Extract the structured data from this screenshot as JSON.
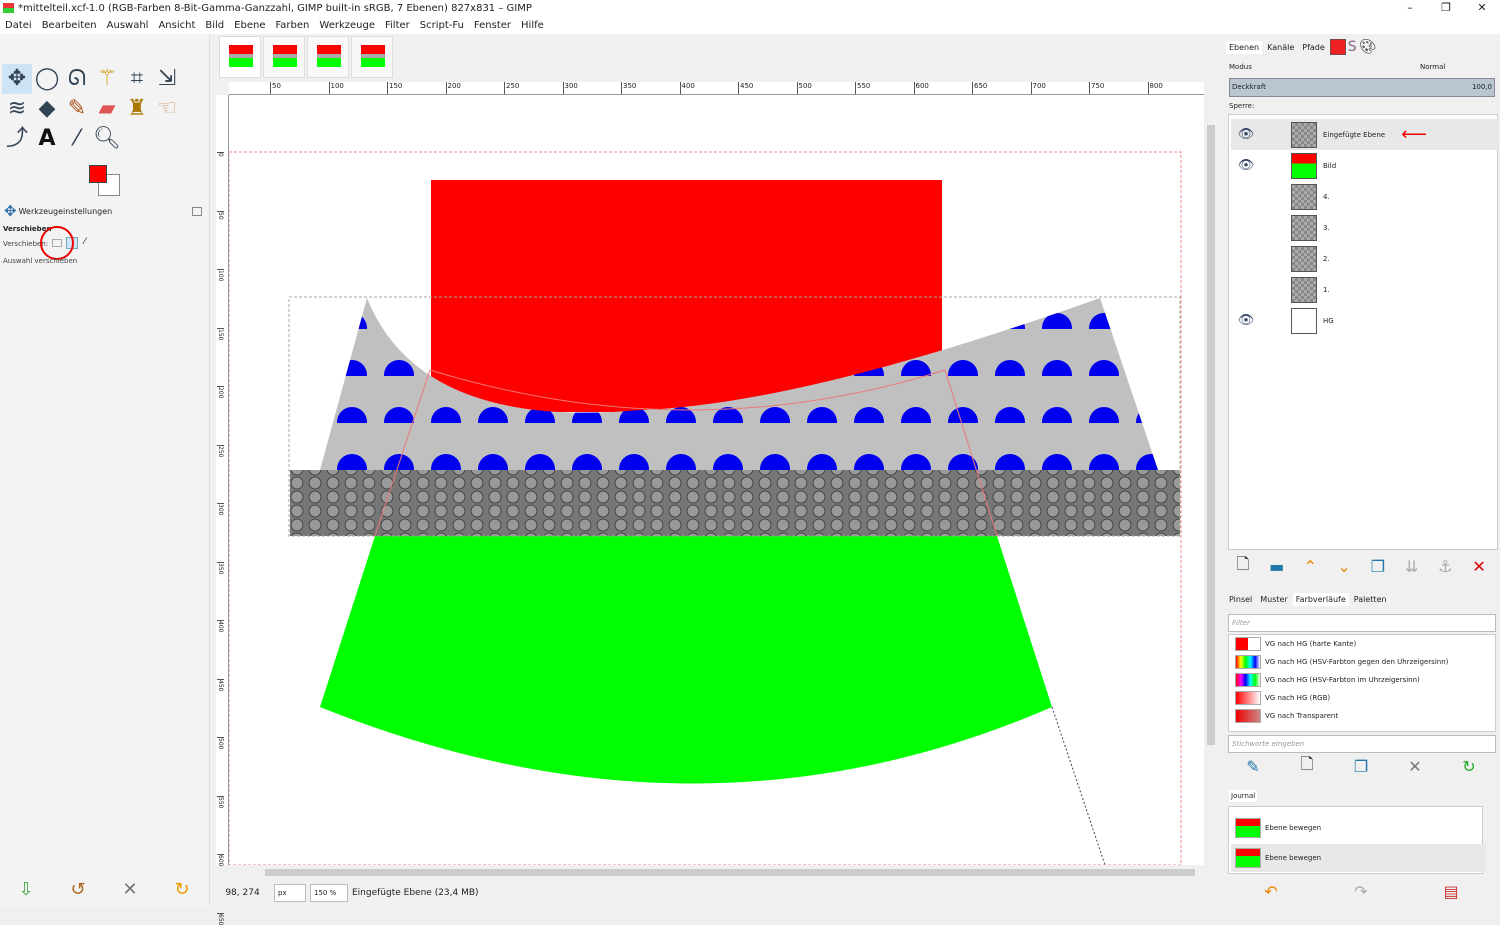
{
  "window": {
    "title": "*mittelteil.xcf-1.0 (RGB-Farben 8-Bit-Gamma-Ganzzahl, GIMP built-in sRGB, 7 Ebenen) 827x831 – GIMP",
    "minimize": "–",
    "restore": "❐",
    "close": "✕"
  },
  "menu": [
    "Datei",
    "Bearbeiten",
    "Auswahl",
    "Ansicht",
    "Bild",
    "Ebene",
    "Farben",
    "Werkzeuge",
    "Filter",
    "Script-Fu",
    "Fenster",
    "Hilfe"
  ],
  "toolbox": {
    "tools": [
      "move",
      "ellipse-select",
      "lasso",
      "fuzzy-select",
      "crop",
      "scale",
      "warp",
      "bucket-fill",
      "paintbrush",
      "eraser",
      "clone",
      "smudge",
      "paths",
      "text",
      "color-picker",
      "zoom"
    ],
    "options_tab": "Werkzeugeinstellungen",
    "tool_name": "Verschieben",
    "move_label": "Verschieben:",
    "move_selection": "Auswahl verschieben"
  },
  "ruler": {
    "labels": [
      "50",
      "100",
      "150",
      "200",
      "250",
      "300",
      "350",
      "400",
      "450",
      "500",
      "550",
      "600",
      "650",
      "700",
      "750",
      "800"
    ],
    "left_labels": [
      "0",
      "50",
      "100",
      "150",
      "200",
      "250",
      "300",
      "350",
      "400",
      "450",
      "500",
      "550",
      "600",
      "650"
    ]
  },
  "status": {
    "coords": "98, 274",
    "unit": "px",
    "zoom": "150 %",
    "info": "Eingefügte Ebene (23,4 MB)"
  },
  "layers_panel": {
    "tabs": [
      "Ebenen",
      "Kanäle",
      "Pfade"
    ],
    "mode_label": "Modus",
    "mode_value": "Normal",
    "opacity_label": "Deckkraft",
    "opacity_value": "100,0",
    "lock_label": "Sperre:",
    "layers": [
      {
        "name": "Eingefügte Ebene",
        "visible": true
      },
      {
        "name": "Bild",
        "visible": true
      },
      {
        "name": "4.",
        "visible": false
      },
      {
        "name": "3.",
        "visible": false
      },
      {
        "name": "2.",
        "visible": false
      },
      {
        "name": "1.",
        "visible": false
      },
      {
        "name": "HG",
        "visible": true
      }
    ]
  },
  "resources_panel": {
    "tabs": [
      "Pinsel",
      "Muster",
      "Farbverläufe",
      "Paletten"
    ],
    "filter_placeholder": "Filter",
    "tags_placeholder": "Stichworte eingeben",
    "gradients": [
      "VG nach HG (harte Kante)",
      "VG nach HG (HSV-Farbton gegen den Uhrzeigersinn)",
      "VG nach HG (HSV-Farbton im Uhrzeigersinn)",
      "VG nach HG (RGB)",
      "VG nach Transparent"
    ]
  },
  "journal": {
    "tab": "Journal",
    "items": [
      "Ebene bewegen",
      "Ebene bewegen"
    ]
  },
  "colors": {
    "fg": "#ff0000",
    "bg": "#ffffff",
    "accent": "#2f6ea8"
  }
}
